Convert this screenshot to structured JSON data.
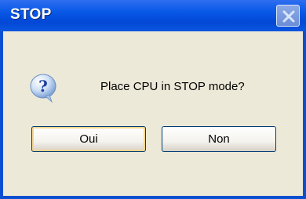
{
  "dialog": {
    "title": "STOP",
    "message": "Place CPU in STOP mode?",
    "icon": "question-icon",
    "buttons": {
      "yes_label": "Oui",
      "no_label": "Non"
    }
  },
  "colors": {
    "titlebar": "#0a5ae8",
    "dialog_background": "#ece9d8",
    "button_focus_ring": "#f9d68f"
  }
}
